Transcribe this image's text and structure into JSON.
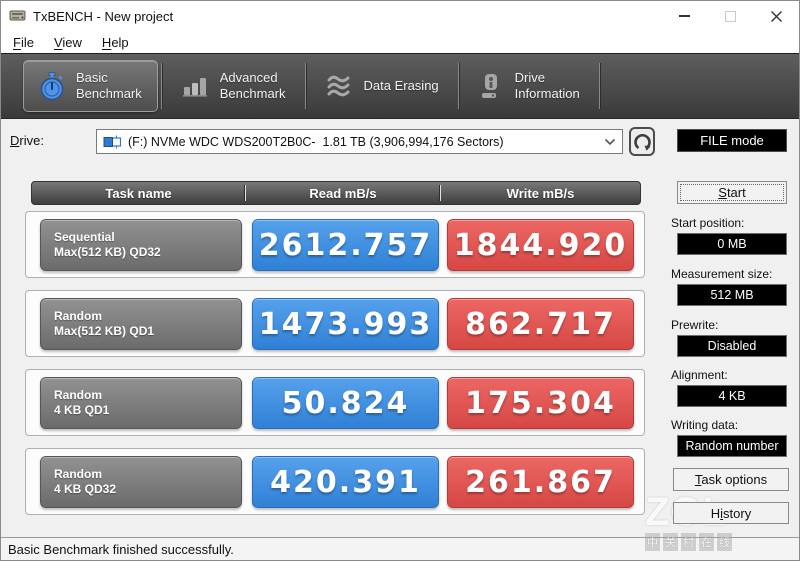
{
  "window": {
    "title": "TxBENCH - New project"
  },
  "menu": {
    "items": [
      {
        "pre": "",
        "u": "F",
        "post": "ile"
      },
      {
        "pre": "",
        "u": "V",
        "post": "iew"
      },
      {
        "pre": "",
        "u": "H",
        "post": "elp"
      }
    ]
  },
  "tabs": [
    {
      "line1": "Basic",
      "line2": "Benchmark",
      "active": true
    },
    {
      "line1": "Advanced",
      "line2": "Benchmark",
      "active": false
    },
    {
      "line1": "Data Erasing",
      "line2": "",
      "active": false
    },
    {
      "line1": "Drive",
      "line2": "Information",
      "active": false
    }
  ],
  "drive": {
    "label": {
      "pre": "",
      "u": "D",
      "post": "rive:"
    },
    "selected": "(F:) NVMe WDC WDS200T2B0C-  1.81 TB (3,906,994,176 Sectors)"
  },
  "mode_button": {
    "label": "FILE mode"
  },
  "table": {
    "headers": [
      "Task name",
      "Read mB/s",
      "Write mB/s"
    ],
    "rows": [
      {
        "name_line1": "Sequential",
        "name_line2": "Max(512 KB) QD32",
        "read": "2612.757",
        "write": "1844.920"
      },
      {
        "name_line1": "Random",
        "name_line2": "Max(512 KB) QD1",
        "read": "1473.993",
        "write": "862.717"
      },
      {
        "name_line1": "Random",
        "name_line2": "4 KB QD1",
        "read": "50.824",
        "write": "175.304"
      },
      {
        "name_line1": "Random",
        "name_line2": "4 KB QD32",
        "read": "420.391",
        "write": "261.867"
      }
    ]
  },
  "panel": {
    "start_button": {
      "pre": "",
      "u": "S",
      "post": "tart"
    },
    "fields": [
      {
        "label": "Start position:",
        "value": "0 MB"
      },
      {
        "label": "Measurement size:",
        "value": "512 MB"
      },
      {
        "label": "Prewrite:",
        "value": "Disabled"
      },
      {
        "label": "Alignment:",
        "value": "4 KB"
      },
      {
        "label": "Writing data:",
        "value": "Random number"
      }
    ],
    "task_options_button": {
      "pre": "",
      "u": "T",
      "post": "ask options"
    },
    "history_button": {
      "pre": "H",
      "u": "i",
      "post": "story"
    }
  },
  "status_bar": {
    "message": "Basic Benchmark finished successfully."
  },
  "watermark": {
    "brand": "ZOL",
    "chars": [
      "中",
      "关",
      "村",
      "在",
      "线"
    ]
  },
  "colors": {
    "read_blue": "#3c8ce0",
    "write_red": "#dd5451",
    "tab_bar_gray": "#474747",
    "field_black": "#000000"
  }
}
